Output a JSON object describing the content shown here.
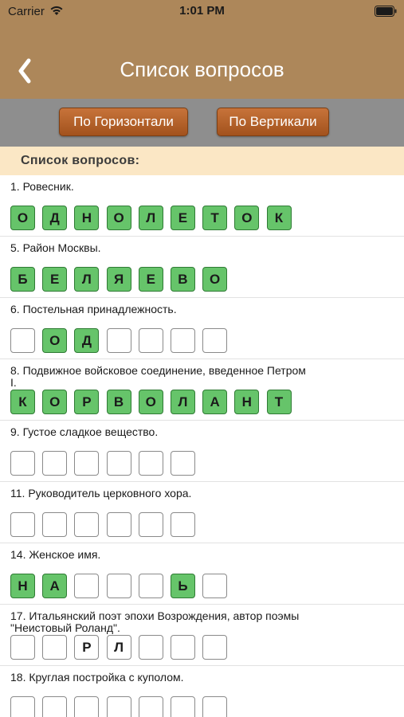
{
  "status_bar": {
    "carrier": "Carrier",
    "time": "1:01 PM"
  },
  "nav": {
    "title": "Список вопросов",
    "back_icon": "chevron-left-icon"
  },
  "segments": {
    "horizontal": "По Горизонтали",
    "vertical": "По Вертикали"
  },
  "section": {
    "title": "Список вопросов:"
  },
  "colors": {
    "header": "#ad875a",
    "segment_bar": "#8e8e8e",
    "button": "#b7642c",
    "section_bg": "#fbe7c5",
    "cell_filled": "#66c46a"
  },
  "questions": [
    {
      "text": "1. Ровесник.",
      "cells": [
        {
          "letter": "О",
          "filled": true
        },
        {
          "letter": "Д",
          "filled": true
        },
        {
          "letter": "Н",
          "filled": true
        },
        {
          "letter": "О",
          "filled": true
        },
        {
          "letter": "Л",
          "filled": true
        },
        {
          "letter": "Е",
          "filled": true
        },
        {
          "letter": "Т",
          "filled": true
        },
        {
          "letter": "О",
          "filled": true
        },
        {
          "letter": "К",
          "filled": true
        }
      ]
    },
    {
      "text": "5. Район Москвы.",
      "cells": [
        {
          "letter": "Б",
          "filled": true
        },
        {
          "letter": "Е",
          "filled": true
        },
        {
          "letter": "Л",
          "filled": true
        },
        {
          "letter": "Я",
          "filled": true
        },
        {
          "letter": "Е",
          "filled": true
        },
        {
          "letter": "В",
          "filled": true
        },
        {
          "letter": "О",
          "filled": true
        }
      ]
    },
    {
      "text": "6. Постельная принадлежность.",
      "cells": [
        {
          "letter": "",
          "filled": false
        },
        {
          "letter": "О",
          "filled": true
        },
        {
          "letter": "Д",
          "filled": true
        },
        {
          "letter": "",
          "filled": false
        },
        {
          "letter": "",
          "filled": false
        },
        {
          "letter": "",
          "filled": false
        },
        {
          "letter": "",
          "filled": false
        }
      ]
    },
    {
      "text": "8. Подвижное войсковое соединение, введенное Петром I.",
      "cells": [
        {
          "letter": "К",
          "filled": true
        },
        {
          "letter": "О",
          "filled": true
        },
        {
          "letter": "Р",
          "filled": true
        },
        {
          "letter": "В",
          "filled": true
        },
        {
          "letter": "О",
          "filled": true
        },
        {
          "letter": "Л",
          "filled": true
        },
        {
          "letter": "А",
          "filled": true
        },
        {
          "letter": "Н",
          "filled": true
        },
        {
          "letter": "Т",
          "filled": true
        }
      ]
    },
    {
      "text": "9. Густое сладкое вещество.",
      "cells": [
        {
          "letter": "",
          "filled": false
        },
        {
          "letter": "",
          "filled": false
        },
        {
          "letter": "",
          "filled": false
        },
        {
          "letter": "",
          "filled": false
        },
        {
          "letter": "",
          "filled": false
        },
        {
          "letter": "",
          "filled": false
        }
      ]
    },
    {
      "text": "11. Руководитель церковного хора.",
      "cells": [
        {
          "letter": "",
          "filled": false
        },
        {
          "letter": "",
          "filled": false
        },
        {
          "letter": "",
          "filled": false
        },
        {
          "letter": "",
          "filled": false
        },
        {
          "letter": "",
          "filled": false
        },
        {
          "letter": "",
          "filled": false
        }
      ]
    },
    {
      "text": "14. Женское имя.",
      "cells": [
        {
          "letter": "Н",
          "filled": true
        },
        {
          "letter": "А",
          "filled": true
        },
        {
          "letter": "",
          "filled": false
        },
        {
          "letter": "",
          "filled": false
        },
        {
          "letter": "",
          "filled": false
        },
        {
          "letter": "Ь",
          "filled": true
        },
        {
          "letter": "",
          "filled": false
        }
      ]
    },
    {
      "text": "17. Итальянский поэт эпохи Возрождения, автор поэмы \"Неистовый Роланд\".",
      "cells": [
        {
          "letter": "",
          "filled": false
        },
        {
          "letter": "",
          "filled": false
        },
        {
          "letter": "Р",
          "filled": false
        },
        {
          "letter": "Л",
          "filled": false
        },
        {
          "letter": "",
          "filled": false
        },
        {
          "letter": "",
          "filled": false
        },
        {
          "letter": "",
          "filled": false
        }
      ]
    },
    {
      "text": "18. Круглая постройка с куполом.",
      "cells": [
        {
          "letter": "",
          "filled": false
        },
        {
          "letter": "",
          "filled": false
        },
        {
          "letter": "",
          "filled": false
        },
        {
          "letter": "",
          "filled": false
        },
        {
          "letter": "",
          "filled": false
        },
        {
          "letter": "",
          "filled": false
        },
        {
          "letter": "",
          "filled": false
        }
      ]
    }
  ]
}
